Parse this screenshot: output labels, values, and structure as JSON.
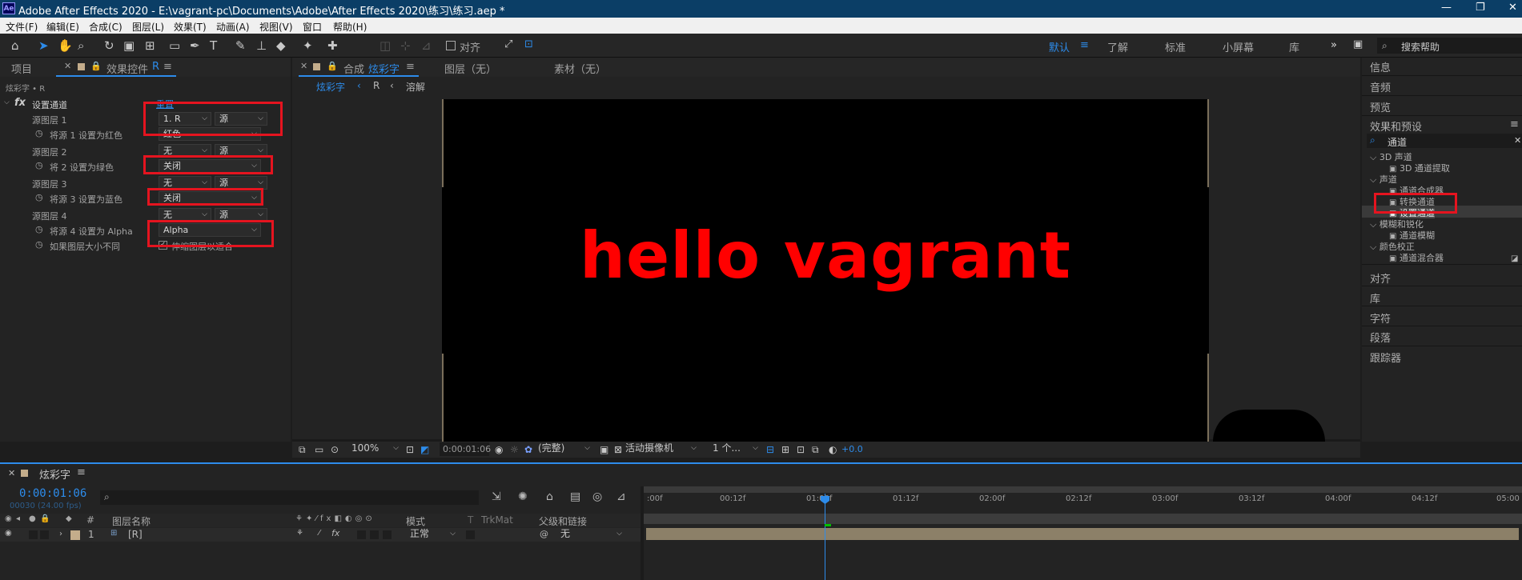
{
  "window": {
    "title": "Adobe After Effects 2020 - E:\\vagrant-pc\\Documents\\Adobe\\After Effects 2020\\练习\\练习.aep *",
    "logo": "Ae",
    "minimize": "—",
    "restore": "❐",
    "close": "✕"
  },
  "menu": [
    "文件(F)",
    "编辑(E)",
    "合成(C)",
    "图层(L)",
    "效果(T)",
    "动画(A)",
    "视图(V)",
    "窗口",
    "帮助(H)"
  ],
  "toolbar": {
    "align_label": "对齐",
    "workspaces": [
      "默认",
      "了解",
      "标准",
      "小屏幕",
      "库"
    ],
    "workspace_menu": "≡",
    "more": "»",
    "search_placeholder": "搜索帮助"
  },
  "left": {
    "tabs": {
      "project": "项目",
      "effects": "效果控件",
      "effects_layer": "R",
      "menu": "≡"
    },
    "breadcrumb": "炫彩字 • R",
    "effect": {
      "fx": "fx",
      "name": "设置通道",
      "reset": "重置"
    },
    "rows": [
      {
        "label": "源图层 1",
        "dd1": "1. R",
        "dd2": "源"
      },
      {
        "label": "将源 1 设置为红色",
        "dd": "红色"
      },
      {
        "label": "源图层 2",
        "dd1": "无",
        "dd2": "源"
      },
      {
        "label": "将 2 设置为绿色",
        "dd": "关闭"
      },
      {
        "label": "源图层 3",
        "dd1": "无",
        "dd2": "源"
      },
      {
        "label": "将源 3 设置为蓝色",
        "dd": "关闭"
      },
      {
        "label": "源图层 4",
        "dd1": "无",
        "dd2": "源"
      },
      {
        "label": "将源 4 设置为 Alpha",
        "dd": "Alpha"
      },
      {
        "label": "如果图层大小不同",
        "check": "伸缩图层以适合"
      }
    ]
  },
  "comp": {
    "tabs": {
      "comp_prefix": "合成",
      "comp_name": "炫彩字",
      "layer": "图层（无）",
      "footage": "素材（无）",
      "menu": "≡"
    },
    "crumbs": [
      "炫彩字",
      "R",
      "溶解"
    ],
    "canvas_text": "hello vagrant",
    "footer": {
      "zoom": "100%",
      "time": "0:00:01:06",
      "quality": "(完整)",
      "camera": "活动摄像机",
      "views": "1 个...",
      "exposure": "+0.0"
    }
  },
  "right": {
    "sections_top": [
      "信息",
      "音频",
      "预览"
    ],
    "effects_title": "效果和预设",
    "search_value": "通道",
    "tree": [
      {
        "level": 0,
        "text": "3D 声道"
      },
      {
        "level": 1,
        "text": "3D 通道提取"
      },
      {
        "level": 0,
        "text": "声道"
      },
      {
        "level": 1,
        "text": "通道合成器"
      },
      {
        "level": 1,
        "text": "转换通道"
      },
      {
        "level": 1,
        "text": "设置通道"
      },
      {
        "level": 0,
        "text": "模糊和锐化"
      },
      {
        "level": 1,
        "text": "通道模糊"
      },
      {
        "level": 0,
        "text": "颜色校正"
      },
      {
        "level": 1,
        "text": "通道混合器"
      }
    ],
    "sections_bottom": [
      "对齐",
      "库",
      "字符",
      "段落",
      "跟踪器"
    ]
  },
  "timeline": {
    "tab": "炫彩字",
    "menu": "≡",
    "timecode": "0:00:01:06",
    "fps": "00030 (24.00 fps)",
    "search_placeholder": "",
    "cols": {
      "num": "#",
      "name": "图层名称",
      "mode": "模式",
      "t": "T",
      "trkmat": "TrkMat",
      "parent": "父级和链接"
    },
    "ruler": [
      ":00f",
      "00:12f",
      "01:00f",
      "01:12f",
      "02:00f",
      "02:12f",
      "03:00f",
      "03:12f",
      "04:00f",
      "04:12f",
      "05:00"
    ],
    "layer": {
      "num": "1",
      "name": "[R]",
      "mode": "正常",
      "parent": "无"
    }
  },
  "colors": {
    "accent": "#2d8ceb",
    "highlight_red": "#e5141f",
    "text_red": "#ff0000",
    "title_bg": "#0b3e66",
    "layer_bar": "#8c8068",
    "label_tan": "#c4ad8b"
  }
}
